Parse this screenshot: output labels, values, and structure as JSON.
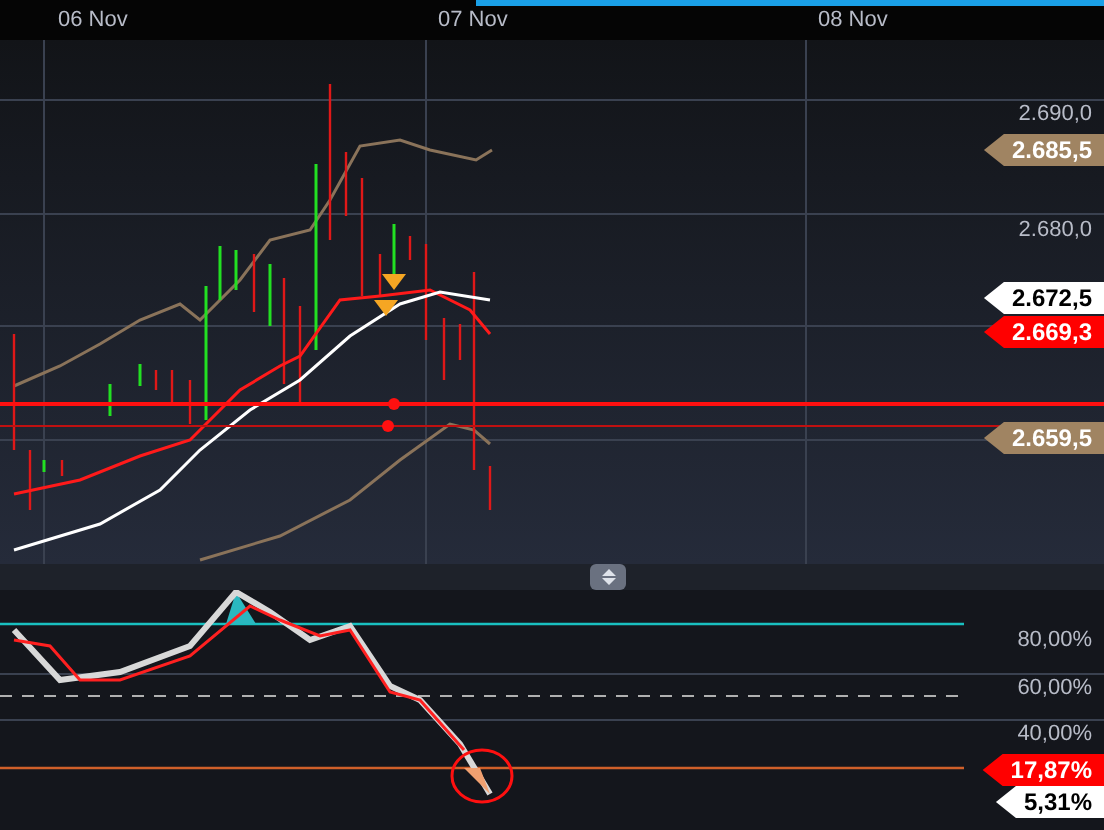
{
  "time_axis": {
    "labels": [
      "06 Nov",
      "07 Nov",
      "08 Nov"
    ]
  },
  "price_panel": {
    "axis_labels": [
      "2.690,0",
      "2.680,0"
    ],
    "price_tags": [
      {
        "text": "2.685,5",
        "color": "#a08462"
      },
      {
        "text": "2.672,5",
        "color": "#ffffff"
      },
      {
        "text": "2.669,3",
        "color": "#ff0000"
      },
      {
        "text": "2.659,5",
        "color": "#a08462"
      }
    ]
  },
  "oscillator_panel": {
    "axis_labels": [
      "80,00%",
      "60,00%",
      "40,00%"
    ],
    "value_tags": [
      {
        "text": "17,87%",
        "color": "#ff0000"
      },
      {
        "text": "5,31%",
        "color": "#ffffff"
      }
    ]
  }
}
